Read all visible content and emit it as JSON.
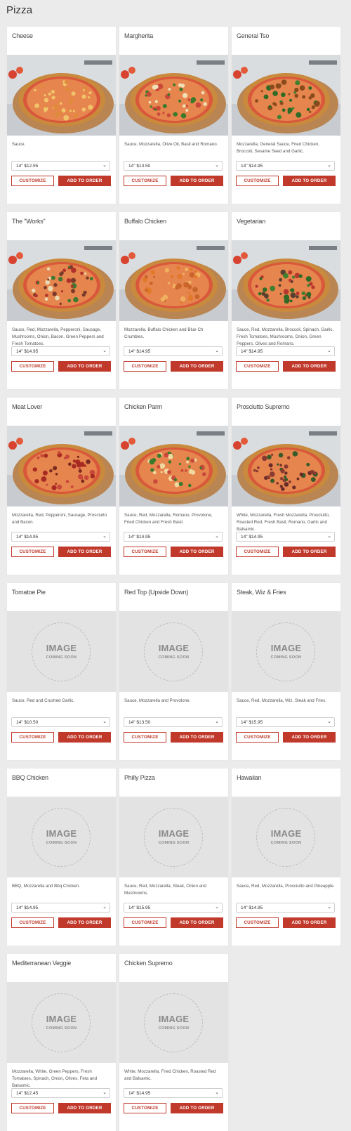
{
  "header": {
    "title": "Pizza"
  },
  "placeholder": {
    "main": "IMAGE",
    "sub": "COMING SOON"
  },
  "buttons": {
    "customize": "CUSTOMIZE",
    "add": "ADD TO ORDER"
  },
  "items": [
    {
      "name": "Cheese",
      "desc": "Sauce.",
      "size": "14\"  $12.95",
      "photo": true,
      "toppings": "cheese"
    },
    {
      "name": "Margherita",
      "desc": "Sauce, Mozzarella, Olive Oil, Basil and Romano.",
      "size": "14\"  $13.50",
      "photo": true,
      "toppings": "basil"
    },
    {
      "name": "General Tso",
      "desc": "Mozzarella, General Sauce, Fried Chicken, Broccoli, Sesame Seed and Garlic.",
      "size": "14\"  $14.95",
      "photo": true,
      "toppings": "broccoli"
    },
    {
      "name": "The \"Works\"",
      "desc": "Sauce, Red, Mozzarella, Pepperoni, Sausage, Mushrooms, Onion, Bacon, Green Peppers and Fresh Tomatoes.",
      "size": "14\"  $14.95",
      "photo": true,
      "toppings": "works"
    },
    {
      "name": "Buffalo Chicken",
      "desc": "Mozzarella, Buffalo Chicken and Blue Ch Crumbles.",
      "size": "14\"  $14.95",
      "photo": true,
      "toppings": "buffalo"
    },
    {
      "name": "Vegetarian",
      "desc": "Sauce, Red, Mozzarella, Broccoli, Spinach, Garlic, Fresh Tomatoes, Mushrooms, Onion, Green Peppers, Olives and Romano.",
      "size": "14\"  $14.95",
      "photo": true,
      "toppings": "veggie"
    },
    {
      "name": "Meat Lover",
      "desc": "Mozzarella, Red, Pepperoni, Sausage, Prosciutto and Bacon.",
      "size": "14\"  $14.95",
      "photo": true,
      "toppings": "meat"
    },
    {
      "name": "Chicken Parm",
      "desc": "Sauce, Red, Mozzarella, Romano, Provolone, Fried Chicken and Fresh Basil.",
      "size": "14\"  $14.95",
      "photo": true,
      "toppings": "parm"
    },
    {
      "name": "Prosciutto Supremo",
      "desc": "White, Mozzarella, Fresh Mozzarella, Prosciutto, Roasted Red, Fresh Basil, Romano, Garlic and Balsamic.",
      "size": "14\"  $14.95",
      "photo": true,
      "toppings": "prosciutto"
    },
    {
      "name": "Tomatoe Pie",
      "desc": "Sauce, Red and Crushed Garlic.",
      "size": "14\"  $10.50",
      "photo": false
    },
    {
      "name": "Red Top (Upside Down)",
      "desc": "Sauce, Mozzarella and Provolone.",
      "size": "14\"  $13.50",
      "photo": false
    },
    {
      "name": "Steak, Wiz & Fries",
      "desc": "Sauce, Red, Mozzarella, Wiz, Steak and Fries.",
      "size": "14\"  $15.95",
      "photo": false
    },
    {
      "name": "BBQ Chicken",
      "desc": "BBQ, Mozzarella and Bbq Chicken.",
      "size": "14\"  $14.95",
      "photo": false
    },
    {
      "name": "Philly Pizza",
      "desc": "Sauce, Red, Mozzarella, Steak, Onion and Mushrooms.",
      "size": "14\"  $15.95",
      "photo": false
    },
    {
      "name": "Hawaiian",
      "desc": "Sauce, Red, Mozzarella, Prosciutto and Pineapple.",
      "size": "14\"  $14.95",
      "photo": false
    },
    {
      "name": "Mediterranean Veggie",
      "desc": "Mozzarella, White, Green Peppers, Fresh Tomatoes, Spinach, Onion, Olives, Feta and Balsamic.",
      "size": "14\"  $12.45",
      "photo": false
    },
    {
      "name": "Chicken Supremo",
      "desc": "White, Mozzarella, Fried Chicken, Roasted Red and Balsamic.",
      "size": "14\"  $14.95",
      "photo": false
    }
  ],
  "colors": {
    "accent": "#c0392b",
    "background": "#ebebeb",
    "card": "#ffffff",
    "placeholder": "#e3e3e3"
  }
}
